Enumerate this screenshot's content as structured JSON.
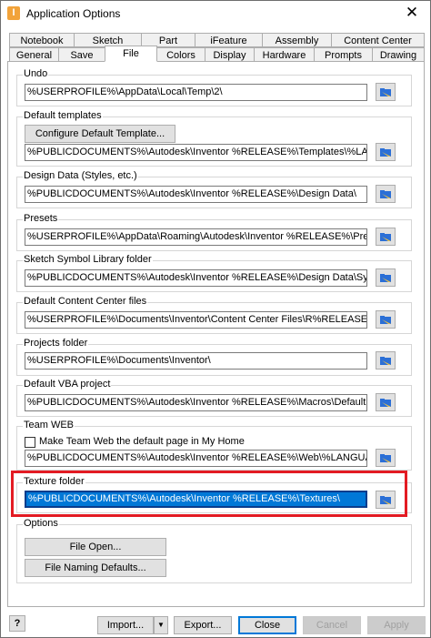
{
  "window": {
    "title": "Application Options",
    "close_glyph": "✕"
  },
  "tabs_row1": [
    {
      "label": "Notebook"
    },
    {
      "label": "Sketch"
    },
    {
      "label": "Part"
    },
    {
      "label": "iFeature"
    },
    {
      "label": "Assembly"
    },
    {
      "label": "Content Center"
    }
  ],
  "tabs_row2": [
    {
      "label": "General"
    },
    {
      "label": "Save"
    },
    {
      "label": "File"
    },
    {
      "label": "Colors"
    },
    {
      "label": "Display"
    },
    {
      "label": "Hardware"
    },
    {
      "label": "Prompts"
    },
    {
      "label": "Drawing"
    }
  ],
  "groups": {
    "undo": {
      "title": "Undo",
      "path": "%USERPROFILE%\\AppData\\Local\\Temp\\2\\"
    },
    "templates": {
      "title": "Default templates",
      "button": "Configure Default Template...",
      "path": "%PUBLICDOCUMENTS%\\Autodesk\\Inventor %RELEASE%\\Templates\\%LANGUAGE%\\"
    },
    "design_data": {
      "title": "Design Data (Styles, etc.)",
      "path": "%PUBLICDOCUMENTS%\\Autodesk\\Inventor %RELEASE%\\Design Data\\"
    },
    "presets": {
      "title": "Presets",
      "path": "%USERPROFILE%\\AppData\\Roaming\\Autodesk\\Inventor %RELEASE%\\Presets\\"
    },
    "sketch_symbol": {
      "title": "Sketch Symbol Library folder",
      "path": "%PUBLICDOCUMENTS%\\Autodesk\\Inventor %RELEASE%\\Design Data\\Symbol Library\\"
    },
    "content_center": {
      "title": "Default Content Center files",
      "path": "%USERPROFILE%\\Documents\\Inventor\\Content Center Files\\R%RELEASE%\\"
    },
    "projects": {
      "title": "Projects folder",
      "path": "%USERPROFILE%\\Documents\\Inventor\\"
    },
    "vba": {
      "title": "Default VBA project",
      "path": "%PUBLICDOCUMENTS%\\Autodesk\\Inventor %RELEASE%\\Macros\\Default.ivb"
    },
    "team_web": {
      "title": "Team WEB",
      "checkbox": "Make Team Web the default page in My Home",
      "path": "%PUBLICDOCUMENTS%\\Autodesk\\Inventor %RELEASE%\\Web\\%LANGUAGE%\\Custom"
    },
    "texture": {
      "title": "Texture folder",
      "path": "%PUBLICDOCUMENTS%\\Autodesk\\Inventor %RELEASE%\\Textures\\"
    },
    "options": {
      "title": "Options",
      "file_open": "File Open...",
      "naming": "File Naming Defaults..."
    }
  },
  "footer": {
    "help": "?",
    "import": "Import...",
    "import_arrow": "▼",
    "export": "Export...",
    "close": "Close",
    "cancel": "Cancel",
    "apply": "Apply"
  },
  "colors": {
    "highlight": "#e31b23",
    "selection": "#0078d7"
  },
  "icons": {
    "browse": "folder-browse-icon"
  }
}
